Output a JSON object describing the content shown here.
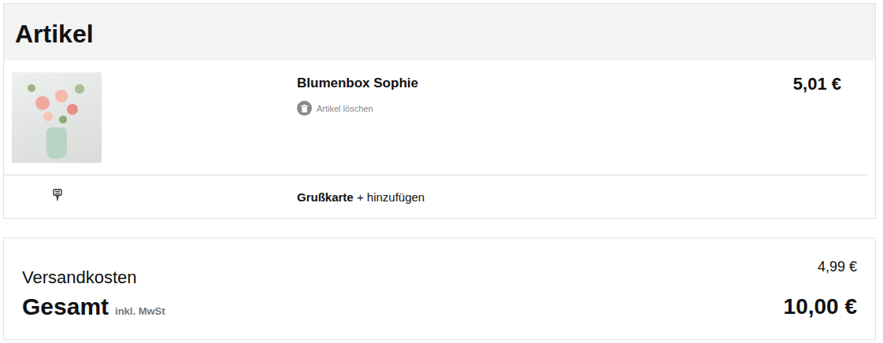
{
  "section": {
    "title": "Artikel"
  },
  "items": [
    {
      "name": "Blumenbox Sophie",
      "delete_label": "Artikel löschen",
      "price": "5,01 €"
    }
  ],
  "greeting_card": {
    "label": "Grußkarte",
    "action": "+ hinzufügen"
  },
  "summary": {
    "shipping_label": "Versandkosten",
    "shipping_value": "4,99 €",
    "total_label": "Gesamt",
    "total_note": "inkl. MwSt",
    "total_value": "10,00 €"
  }
}
